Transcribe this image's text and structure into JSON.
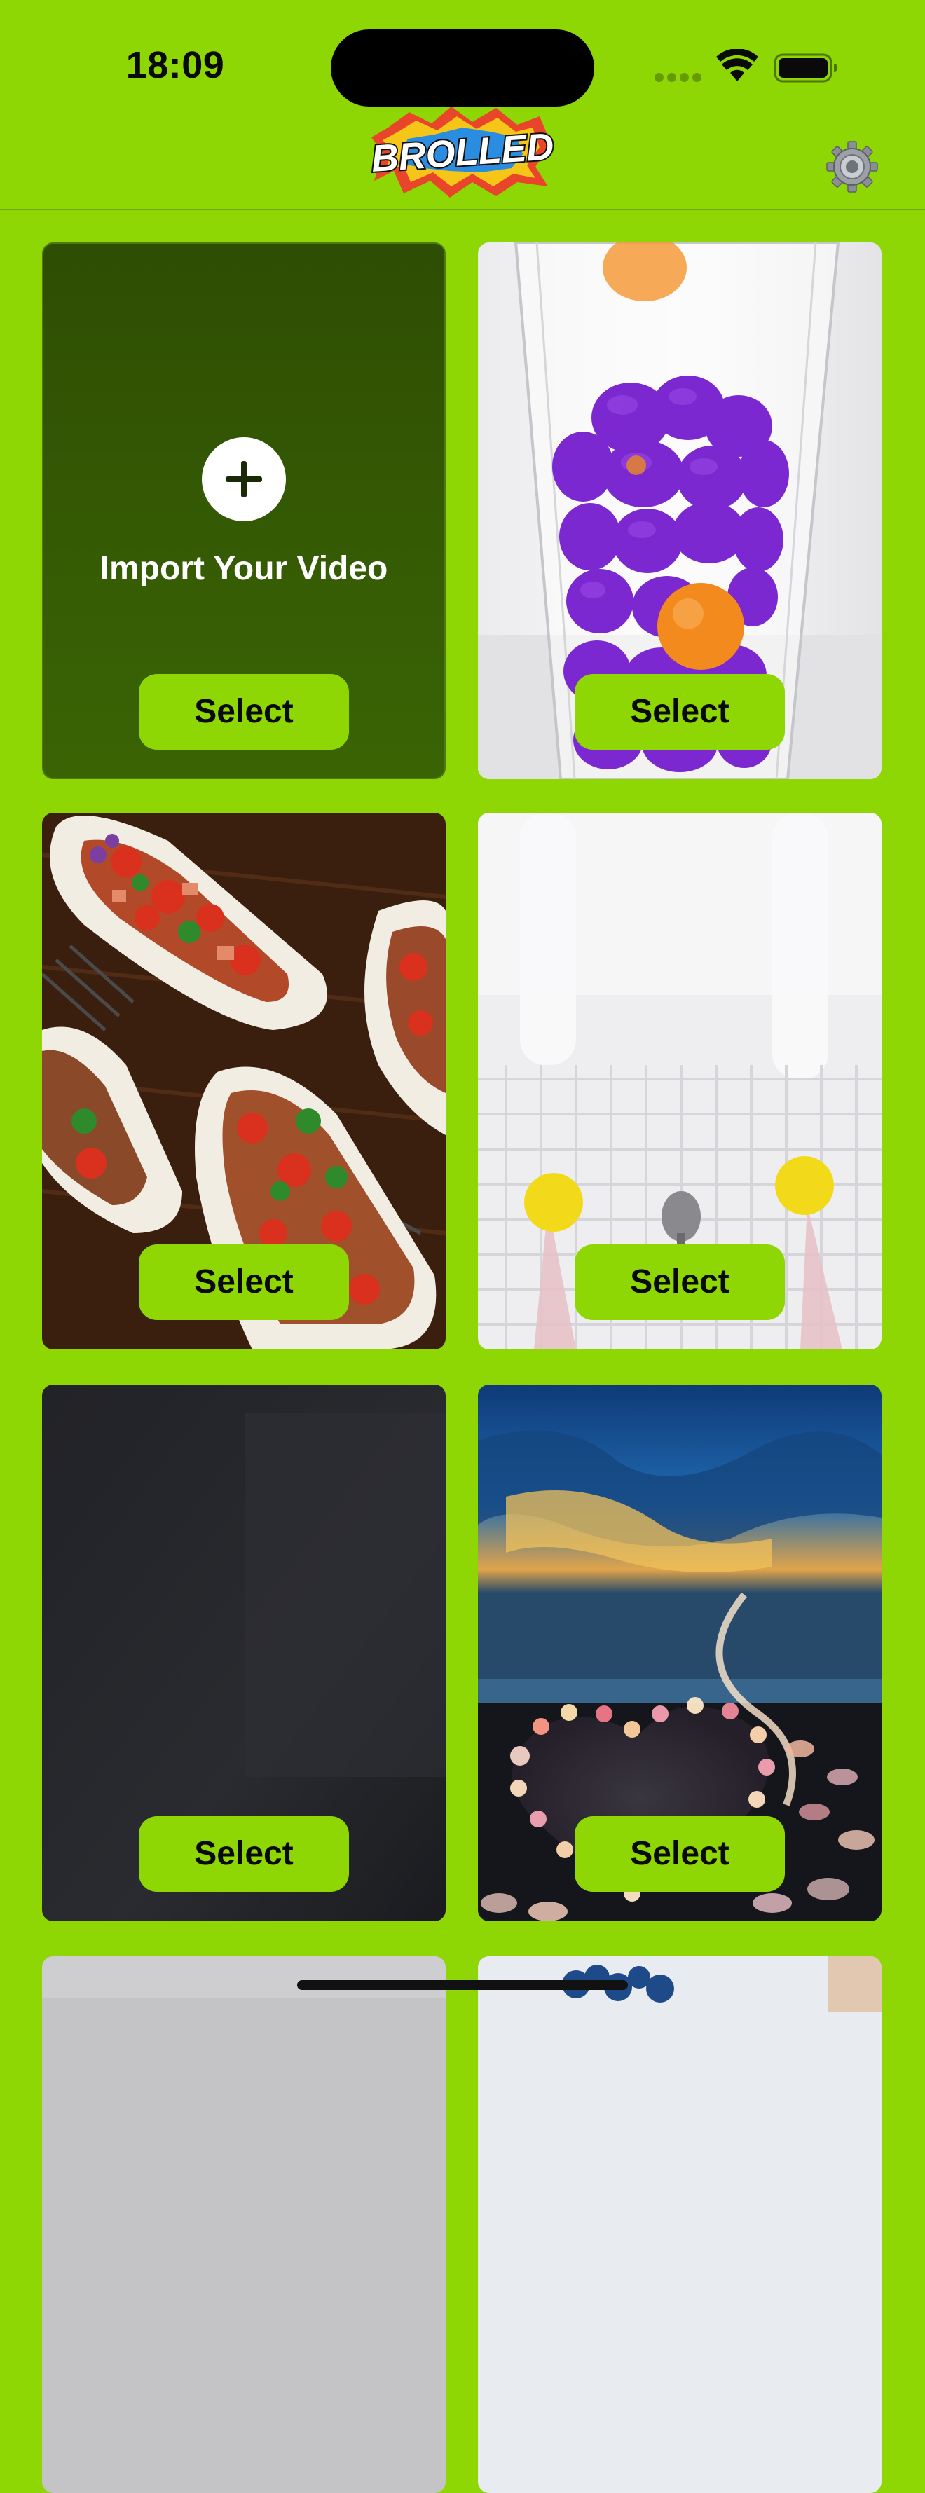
{
  "status_bar": {
    "time": "18:09",
    "icons": [
      "cell-signal-icon",
      "wifi-icon",
      "battery-icon"
    ]
  },
  "header": {
    "logo_text": "BROLLED",
    "settings_icon": "gear-icon"
  },
  "theme": {
    "accent": "#8ED604",
    "import_tile_bg": "#2E4E03",
    "text_dark": "#0a0a0a"
  },
  "grid": {
    "import_tile": {
      "label": "Import Your Video",
      "icon": "plus-icon",
      "button_label": "Select"
    },
    "videos": [
      {
        "thumbnail": "purple-and-orange-clay-balls-in-glass",
        "button_label": "Select"
      },
      {
        "thumbnail": "tacos-on-wooden-board",
        "button_label": "Select"
      },
      {
        "thumbnail": "white-textured-surface-with-yellow-balls",
        "button_label": "Select"
      },
      {
        "thumbnail": "dark-gray-room",
        "button_label": "Select"
      },
      {
        "thumbnail": "glowing-heart-of-pebbles-on-beach",
        "button_label": "Select"
      },
      {
        "thumbnail": "gray-partial-tile",
        "button_label": ""
      },
      {
        "thumbnail": "blue-partial-tile",
        "button_label": ""
      }
    ]
  }
}
